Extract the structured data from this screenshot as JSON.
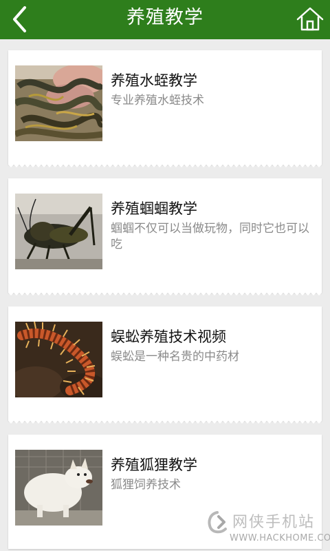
{
  "header": {
    "title": "养殖教学",
    "back_icon": "chevron-left-icon",
    "home_icon": "home-icon",
    "bg_color": "#2e7e1c"
  },
  "items": [
    {
      "title": "养殖水蛭教学",
      "desc": "专业养殖水蛭技术",
      "image": "leech-photo"
    },
    {
      "title": "养殖蝈蝈教学",
      "desc": "蝈蝈不仅可以当做玩物，同时它也可以吃",
      "image": "katydid-photo"
    },
    {
      "title": "蜈蚣养殖技术视频",
      "desc": "蜈蚣是一种名贵的中药材",
      "image": "centipede-photo"
    },
    {
      "title": "养殖狐狸教学",
      "desc": "狐狸饲养技术",
      "image": "fox-photo"
    }
  ],
  "watermark": {
    "name": "网侠手机站",
    "url": "WWW.HACKHOME.COM"
  }
}
